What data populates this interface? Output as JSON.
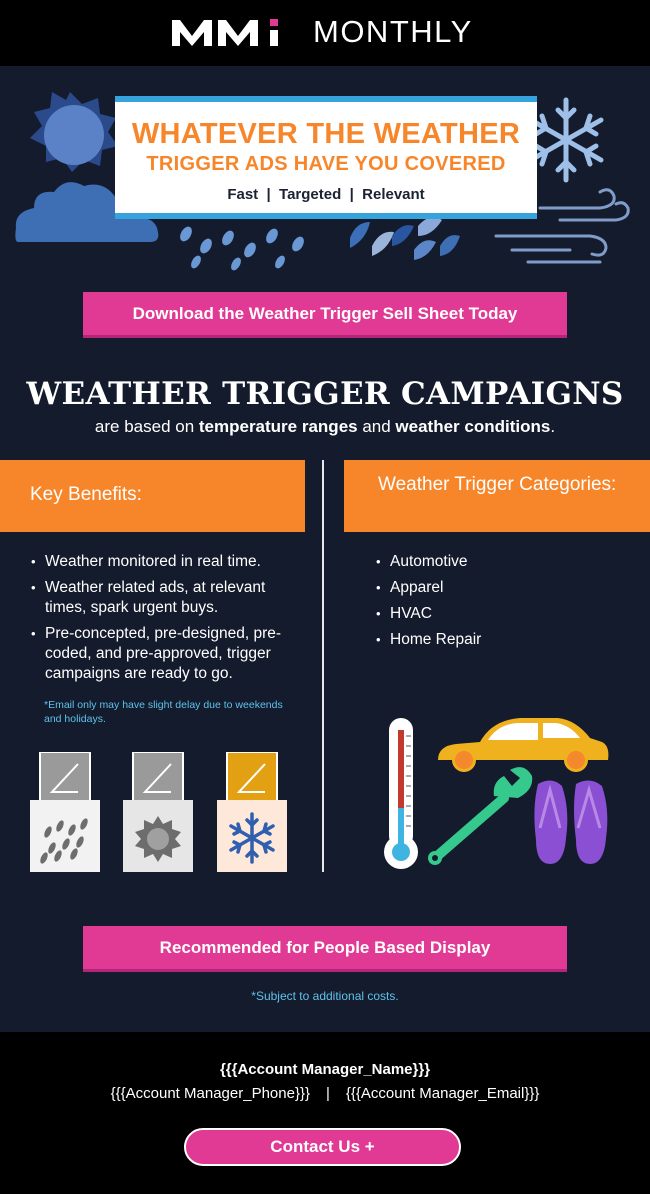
{
  "header": {
    "logo_text": "MONTHLY",
    "logo_mark": "MMi"
  },
  "hero": {
    "title_line1": "WHATEVER THE WEATHER",
    "title_line2": "TRIGGER ADS HAVE YOU COVERED",
    "tagline": "Fast  |  Targeted  |  Relevant"
  },
  "buttons": {
    "download": "Download the Weather Trigger Sell Sheet Today",
    "recommended": "Recommended for People Based Display",
    "contact": "Contact Us +"
  },
  "section": {
    "title": "WEATHER TRIGGER CAMPAIGNS",
    "sub_pre": "are based on ",
    "sub_b1": "temperature ranges",
    "sub_mid": " and ",
    "sub_b2": "weather conditions",
    "sub_post": "."
  },
  "benefits": {
    "heading": "Key Benefits:",
    "items": [
      "Weather monitored in real time.",
      "Weather related ads, at relevant times, spark urgent buys.",
      "Pre-concepted, pre-designed, pre-coded, and pre-approved, trigger campaigns are ready to go."
    ],
    "note": "*Email only may have slight delay due to weekends and holidays."
  },
  "categories": {
    "heading": "Weather Trigger Categories:",
    "items": [
      "Automotive",
      "Apparel",
      "HVAC",
      "Home Repair"
    ]
  },
  "subject_note": "*Subject to additional costs.",
  "footer": {
    "name": "{{{Account Manager_Name}}}",
    "phone": "{{{Account Manager_Phone}}}",
    "separator": "|",
    "email": "{{{Account Manager_Email}}}"
  },
  "colors": {
    "background": "#141b2c",
    "orange": "#f7862b",
    "pink": "#e03a94",
    "blue": "#37a3dd",
    "note_blue": "#5fc2ec"
  },
  "icons": [
    "sun-icon",
    "cloud-icon",
    "snowflake-icon",
    "wind-icon",
    "rain-drops-icon",
    "leaves-icon",
    "thermometer-icon",
    "car-icon",
    "wrench-icon",
    "flip-flops-icon"
  ]
}
